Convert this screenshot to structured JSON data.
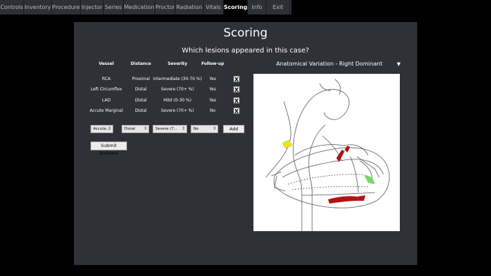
{
  "tabs": [
    {
      "label": "Controls",
      "active": false
    },
    {
      "label": "Inventory",
      "active": false
    },
    {
      "label": "Procedure",
      "active": false
    },
    {
      "label": "Injector",
      "active": false
    },
    {
      "label": "Series",
      "active": false
    },
    {
      "label": "Medication",
      "active": false
    },
    {
      "label": "Proctor",
      "active": false
    },
    {
      "label": "Radiation",
      "active": false
    },
    {
      "label": "Vitals",
      "active": false
    },
    {
      "label": "Scoring",
      "active": true
    },
    {
      "label": "Info",
      "active": false
    },
    {
      "label": "Exit",
      "active": false
    }
  ],
  "scoring": {
    "title": "Scoring",
    "question": "Which lesions appeared in this case?",
    "headers": {
      "vessel": "Vessel",
      "distance": "Distance",
      "severity": "Severity",
      "followup": "Follow-up"
    },
    "rows": [
      {
        "vessel": "RCA",
        "distance": "Proximal",
        "severity": "Intermediate (30-70 %)",
        "followup": "Yes",
        "remove": "X"
      },
      {
        "vessel": "Left Circumflex",
        "distance": "Distal",
        "severity": "Severe (70+ %)",
        "followup": "Yes",
        "remove": "X"
      },
      {
        "vessel": "LAD",
        "distance": "Distal",
        "severity": "Mild (0-30 %)",
        "followup": "Yes",
        "remove": "X"
      },
      {
        "vessel": "Accute Marginal",
        "distance": "Distal",
        "severity": "Severe (70+ %)",
        "followup": "No",
        "remove": "X"
      }
    ],
    "selects": {
      "vessel": "Accute...",
      "distance": "Distal",
      "severity": "Severe (7...",
      "followup": "No"
    },
    "add_label": "Add",
    "submit_label": "Submit Answers",
    "variation": "Anatomical Variation - Right Dominant",
    "variation_caret": "▼",
    "colors": {
      "panel": "#303138",
      "lesion_red": "#b01515",
      "lesion_yellow": "#f2e600",
      "lesion_green": "#7bd66a"
    }
  }
}
